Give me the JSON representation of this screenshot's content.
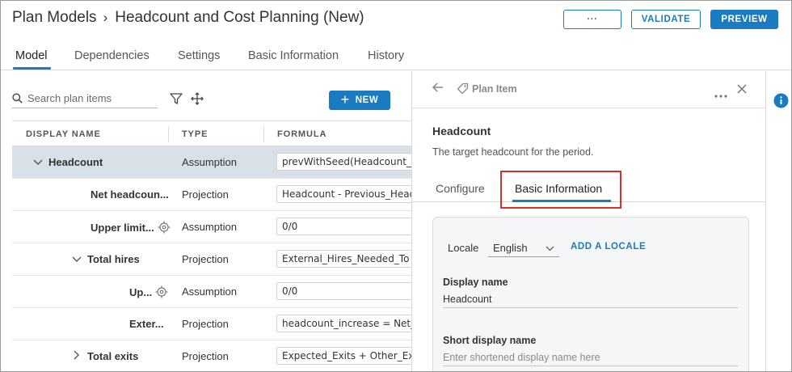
{
  "header": {
    "breadcrumb_root": "Plan Models",
    "breadcrumb_separator": "›",
    "title": "Headcount and Cost Planning (New)",
    "more_label": "···",
    "validate_label": "VALIDATE",
    "preview_label": "PREVIEW"
  },
  "tabs": [
    {
      "label": "Model",
      "active": true
    },
    {
      "label": "Dependencies",
      "active": false
    },
    {
      "label": "Settings",
      "active": false
    },
    {
      "label": "Basic Information",
      "active": false
    },
    {
      "label": "History",
      "active": false
    }
  ],
  "toolbar": {
    "search_placeholder": "Search plan items",
    "new_plus": "+",
    "new_label": "NEW"
  },
  "table": {
    "columns": [
      "DISPLAY NAME",
      "TYPE",
      "FORMULA"
    ],
    "rows": [
      {
        "name": "Headcount",
        "caret": "expanded",
        "type": "Assumption",
        "formula": "prevWithSeed(Headcount_",
        "selected": true,
        "target": false
      },
      {
        "name": "Net headcoun...",
        "caret": "none",
        "type": "Projection",
        "formula": "Headcount - Previous_Head",
        "selected": false,
        "target": false
      },
      {
        "name": "Upper limit...",
        "caret": "none",
        "type": "Assumption",
        "formula": "0/0",
        "selected": false,
        "target": true
      },
      {
        "name": "Total hires",
        "caret": "expanded",
        "type": "Projection",
        "formula": "External_Hires_Needed_To",
        "selected": false,
        "target": false
      },
      {
        "name": "Up...",
        "caret": "none",
        "type": "Assumption",
        "formula": "0/0",
        "selected": false,
        "target": true
      },
      {
        "name": "Exter...",
        "caret": "none",
        "type": "Projection",
        "formula": "headcount_increase = Net_",
        "selected": false,
        "target": false
      },
      {
        "name": "Total exits",
        "caret": "collapsed",
        "type": "Projection",
        "formula": "Expected_Exits + Other_Ex",
        "selected": false,
        "target": false
      }
    ]
  },
  "panel": {
    "header_title": "Plan Item",
    "item_title": "Headcount",
    "item_description": "The target headcount for the period.",
    "subtabs": [
      {
        "label": "Configure",
        "active": false
      },
      {
        "label": "Basic Information",
        "active": true
      }
    ],
    "locale_label": "Locale",
    "locale_value": "English",
    "add_locale_label": "ADD A LOCALE",
    "display_name_label": "Display name",
    "display_name_value": "Headcount",
    "short_display_name_label": "Short display name",
    "short_display_name_placeholder": "Enter shortened display name here"
  },
  "colors": {
    "accent": "#1a7bc1",
    "highlight": "#d9302b",
    "selected_row": "#d8e0e8"
  },
  "icons": {
    "search": "search-icon",
    "filter": "filter-icon",
    "move": "move-icon",
    "back": "back-arrow-icon",
    "tag": "tag-icon",
    "more": "more-horizontal-icon",
    "close": "close-icon",
    "info": "info-icon",
    "target": "target-icon",
    "chevron": "chevron-down-icon"
  }
}
